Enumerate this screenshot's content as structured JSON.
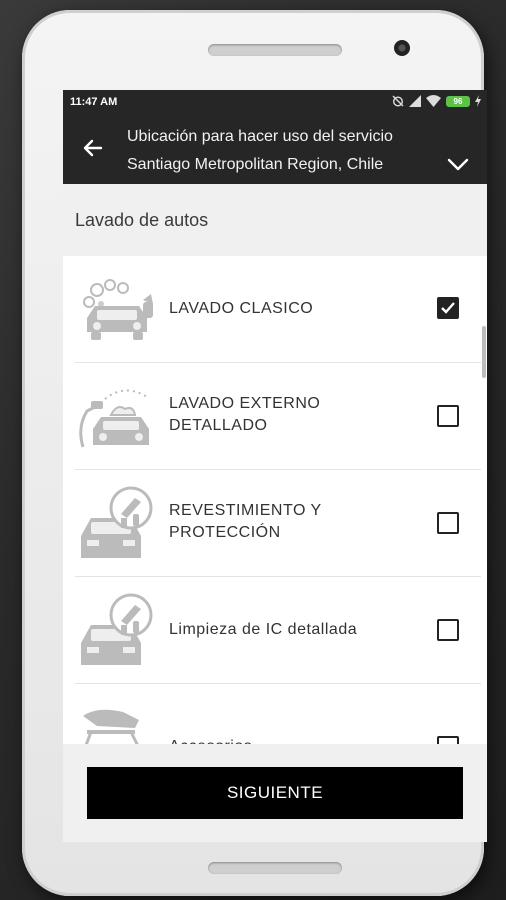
{
  "status_bar": {
    "time": "11:47 AM",
    "battery": "96"
  },
  "toolbar": {
    "title": "Ubicación para hacer uso del servicio",
    "location": "Santiago Metropolitan Region, Chile"
  },
  "section": {
    "title": "Lavado de autos"
  },
  "items": [
    {
      "label": "LAVADO CLASICO",
      "checked": true
    },
    {
      "label": "LAVADO EXTERNO DETALLADO",
      "checked": false
    },
    {
      "label": "REVESTIMIENTO Y PROTECCIÓN",
      "checked": false
    },
    {
      "label": "Limpieza de IC detallada",
      "checked": false
    },
    {
      "label": "Accesorios",
      "checked": false
    }
  ],
  "next_button": {
    "label": "SIGUIENTE"
  }
}
